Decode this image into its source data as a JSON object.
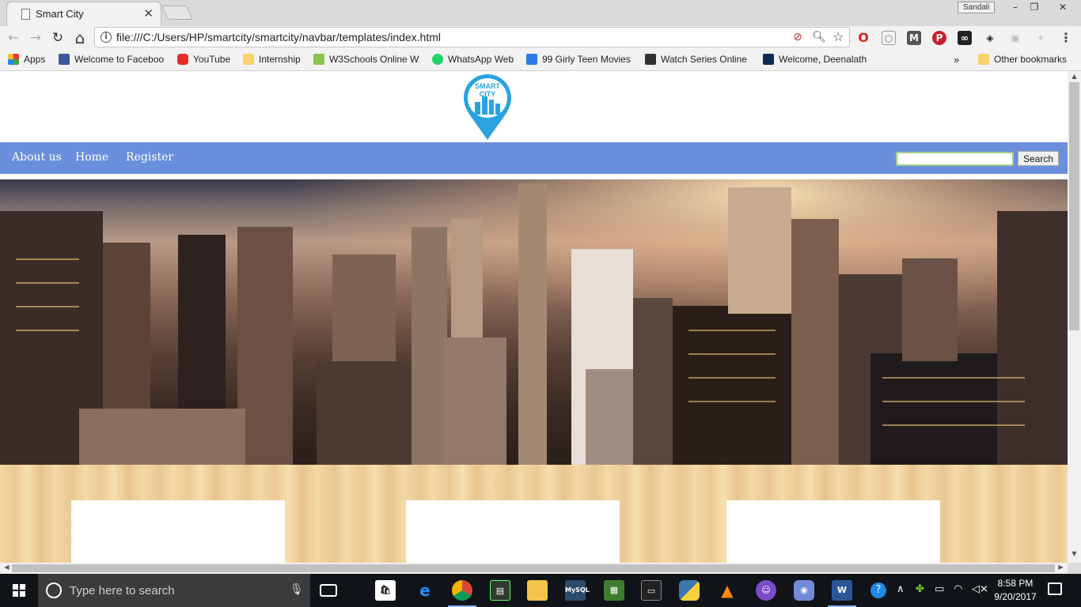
{
  "tab": {
    "title": "Smart City"
  },
  "profile": {
    "name": "Sandali"
  },
  "window_controls": {
    "minimize": "–",
    "restore": "❐",
    "close": "✕"
  },
  "toolbar": {
    "back": "←",
    "forward": "→",
    "reload": "↻",
    "home": "⌂",
    "url": "file:///C:/Users/HP/smartcity/smartcity/navbar/templates/index.html",
    "info": "i"
  },
  "bookmarks": {
    "apps": "Apps",
    "items": [
      {
        "label": "Welcome to Faceboo"
      },
      {
        "label": "YouTube"
      },
      {
        "label": "Internship"
      },
      {
        "label": "W3Schools Online W"
      },
      {
        "label": "WhatsApp Web"
      },
      {
        "label": "99 Girly Teen Movies"
      },
      {
        "label": "Watch Series Online"
      },
      {
        "label": "Welcome, Deenalath"
      }
    ],
    "more": "»",
    "other": "Other bookmarks"
  },
  "site": {
    "logo_text_1": "SMART",
    "logo_text_2": "CITY",
    "nav": [
      "About us",
      "Home",
      "Register"
    ],
    "search_value": "",
    "search_button": "Search"
  },
  "taskbar": {
    "search_placeholder": "Type here to search",
    "time": "8:58 PM",
    "date": "9/20/2017"
  },
  "colors": {
    "nav_blue": "#6a8fdc",
    "logo_blue": "#2aa3e0",
    "wood": "#f2d7a3",
    "taskbar": "#101418"
  }
}
